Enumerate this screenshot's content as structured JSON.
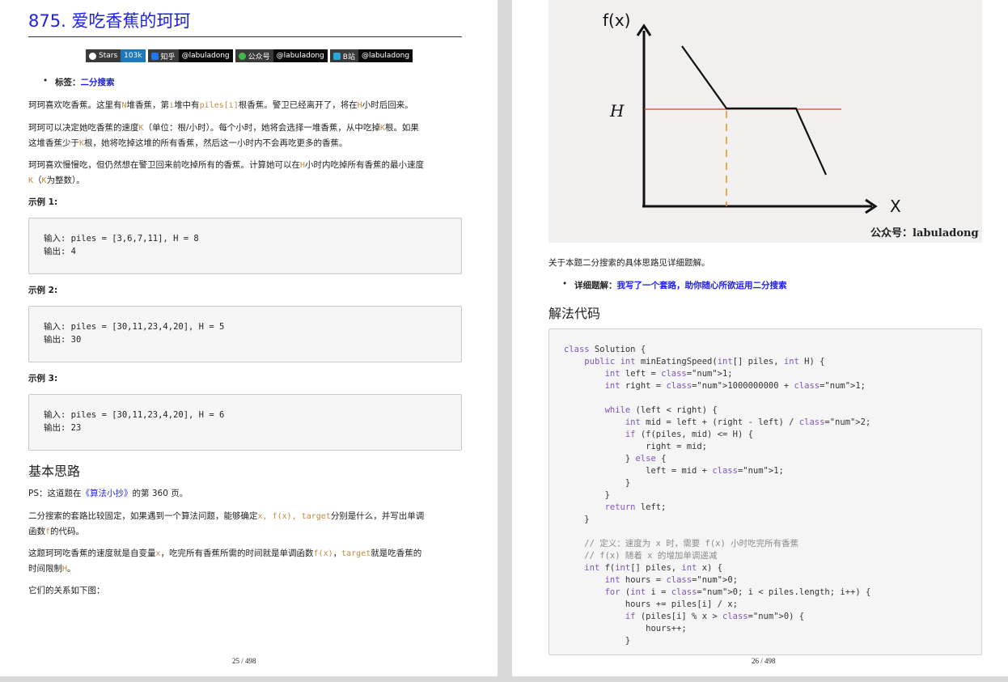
{
  "left_page": {
    "title": "875. 爱吃香蕉的珂珂",
    "badges": [
      {
        "label": "Stars",
        "value": "103k",
        "icon": "github-icon"
      },
      {
        "label": "知乎",
        "value": "@labuladong",
        "icon": "zhihu-icon"
      },
      {
        "label": "公众号",
        "value": "@labuladong",
        "icon": "wechat-icon"
      },
      {
        "label": "B站",
        "value": "@labuladong",
        "icon": "bilibili-icon"
      }
    ],
    "tag_label": "标签：",
    "tag_link": "二分搜索",
    "para1": [
      "珂珂喜欢吃香蕉。这里有",
      "N",
      "堆香蕉，第",
      "i",
      "堆中有",
      "piles[i]",
      "根香蕉。警卫已经离开了，将在",
      "H",
      "小时后回来。"
    ],
    "para2a": [
      "珂珂可以决定她吃香蕉的速度",
      "K",
      "（单位：根/小时）。每个小时，她将会选择一堆香蕉，从中吃掉",
      "K",
      "根。如果"
    ],
    "para2b": [
      "这堆香蕉少于",
      "K",
      "根，她将吃掉这堆的所有香蕉，然后这一小时内不会再吃更多的香蕉。"
    ],
    "para3a": [
      "珂珂喜欢慢慢吃，但仍然想在警卫回来前吃掉所有的香蕉。计算她可以在",
      "H",
      "小时内吃掉所有香蕉的最小速度"
    ],
    "para3b": [
      "K",
      "（",
      "K",
      "为整数）。"
    ],
    "examples": [
      {
        "heading": "示例 1:",
        "input": "输入: piles = [3,6,7,11], H = 8",
        "output": "输出: 4"
      },
      {
        "heading": "示例 2:",
        "input": "输入: piles = [30,11,23,4,20], H = 5",
        "output": "输出: 30"
      },
      {
        "heading": "示例 3:",
        "input": "输入: piles = [30,11,23,4,20], H = 6",
        "output": "输出: 23"
      }
    ],
    "section_title": "基本思路",
    "ps": [
      "PS：这道题在",
      "《算法小抄》",
      "的第 360 页。"
    ],
    "para4a": [
      "二分搜索的套路比较固定，如果遇到一个算法问题，能够确定",
      "x, f(x), target",
      "分别是什么，并写出单调"
    ],
    "para4b": [
      "函数",
      "f",
      "的代码。"
    ],
    "para5a": [
      "这题珂珂吃香蕉的速度就是自变量",
      "x",
      "，吃完所有香蕉所需的时间就是单调函数",
      "f(x)",
      "，",
      "target",
      "就是吃香蕉的"
    ],
    "para5b": [
      "时间限制",
      "H",
      "。"
    ],
    "para6": "它们的关系如下图：",
    "footer": "25 / 498"
  },
  "right_page": {
    "figure": {
      "y_axis_label": "f(x)",
      "x_axis_label": "X",
      "h_label": "H",
      "watermark": "公众号：labuladong",
      "colors": {
        "h_line": "#e0393b",
        "dashed": "#f08a24",
        "axis": "#111111"
      }
    },
    "para1": "关于本题二分搜索的具体思路见详细题解。",
    "detail_label": "详细题解：",
    "detail_link": "我写了一个套路，助你随心所欲运用二分搜索",
    "section_title": "解法代码",
    "code": [
      "class Solution {",
      "    public int minEatingSpeed(int[] piles, int H) {",
      "        int left = 1;",
      "        int right = 1000000000 + 1;",
      "",
      "        while (left < right) {",
      "            int mid = left + (right - left) / 2;",
      "            if (f(piles, mid) <= H) {",
      "                right = mid;",
      "            } else {",
      "                left = mid + 1;",
      "            }",
      "        }",
      "        return left;",
      "    }",
      "",
      "    // 定义：速度为 x 时，需要 f(x) 小时吃完所有香蕉",
      "    // f(x) 随着 x 的增加单调递减",
      "    int f(int[] piles, int x) {",
      "        int hours = 0;",
      "        for (int i = 0; i < piles.length; i++) {",
      "            hours += piles[i] / x;",
      "            if (piles[i] % x > 0) {",
      "                hours++;",
      "            }"
    ],
    "footer": "26 / 498"
  }
}
